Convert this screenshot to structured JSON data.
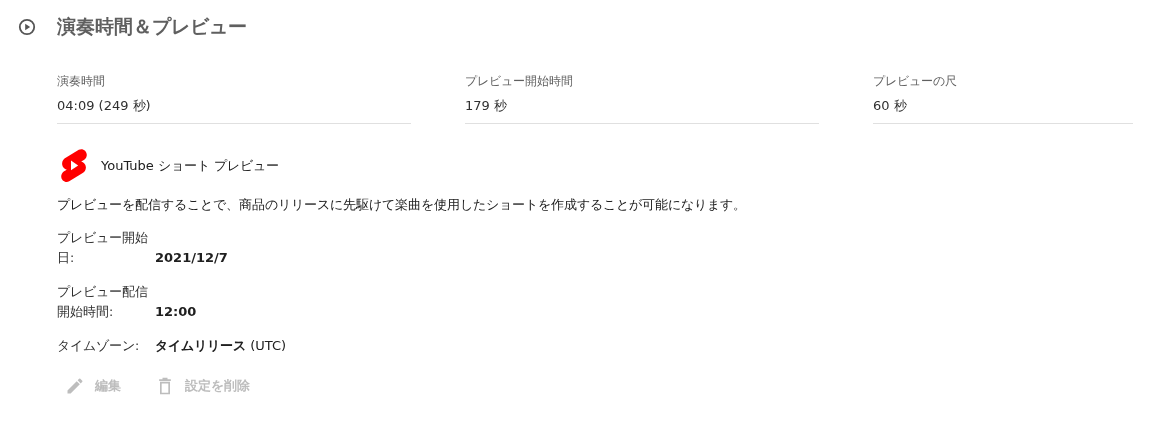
{
  "section": {
    "title": "演奏時間＆プレビュー"
  },
  "fields": [
    {
      "label": "演奏時間",
      "value": "04:09 (249 秒)"
    },
    {
      "label": "プレビュー開始時間",
      "value": "179 秒"
    },
    {
      "label": "プレビューの尺",
      "value": "60 秒"
    }
  ],
  "shorts_preview": {
    "title": "YouTube ショート プレビュー",
    "description": "プレビューを配信することで、商品のリリースに先駆けて楽曲を使用したショートを作成することが可能になります。",
    "details": [
      {
        "kind": "date",
        "label": "プレビュー開始日:",
        "value": "2021/12/7"
      },
      {
        "kind": "time",
        "label": "プレビュー配信開始時間:",
        "value": "12:00"
      },
      {
        "kind": "timezone",
        "label": "タイムゾーン:",
        "value": "**タイムリリース** (UTC)"
      }
    ]
  },
  "actions": [
    {
      "kind": "edit",
      "label": "編集",
      "disabled": true
    },
    {
      "kind": "delete",
      "label": "設定を削除",
      "disabled": true
    }
  ]
}
